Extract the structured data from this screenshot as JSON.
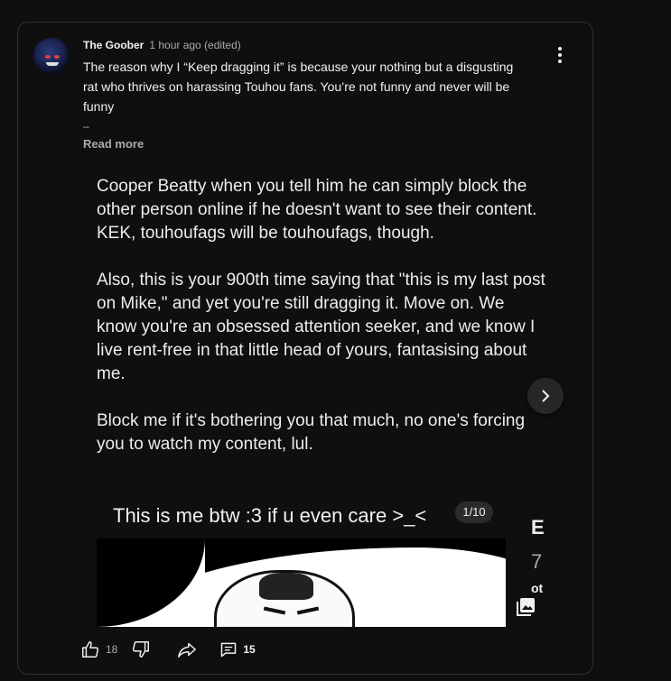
{
  "comment": {
    "author": "The Goober",
    "meta": "1 hour ago (edited)",
    "text": "The reason why I “Keep dragging it” is because your nothing but a disgusting rat who thrives on harassing Touhou fans. You’re not funny and never will be funny",
    "ellipsis": "–",
    "read_more": "Read more",
    "avatar_icon": "avatar-image",
    "menu_icon": "more-vert-icon"
  },
  "carousel": {
    "slide_text": "Cooper Beatty when you tell him he can simply block the other person online if he doesn't want to see their content. KEK, touhoufags will be touhoufags, though.\n\nAlso, this is your 900th time saying that \"this is my last post on Mike,\" and yet you're still dragging it. Move on. We know you're an obsessed attention seeker, and we know I live rent-free in that little head of yours, fantasising about me.\n\nBlock me if it's bothering you that much, no one's forcing you to watch my content, lul.",
    "caption": "This is me btw :3 if u even care >_<",
    "counter": "1/10",
    "peek_letter": "E",
    "peek_number": "7",
    "peek_more": "ot",
    "next_icon": "chevron-right-icon",
    "gallery_icon": "image-multiple-icon"
  },
  "actions": {
    "likes": "18",
    "replies": "15",
    "like_icon": "thumb-up-icon",
    "dislike_icon": "thumb-down-icon",
    "share_icon": "share-icon",
    "reply_icon": "comment-icon"
  },
  "colors": {
    "background": "#0f0f0f",
    "text": "#f1f1f1",
    "secondary": "#aaaaaa",
    "border": "#303030"
  }
}
